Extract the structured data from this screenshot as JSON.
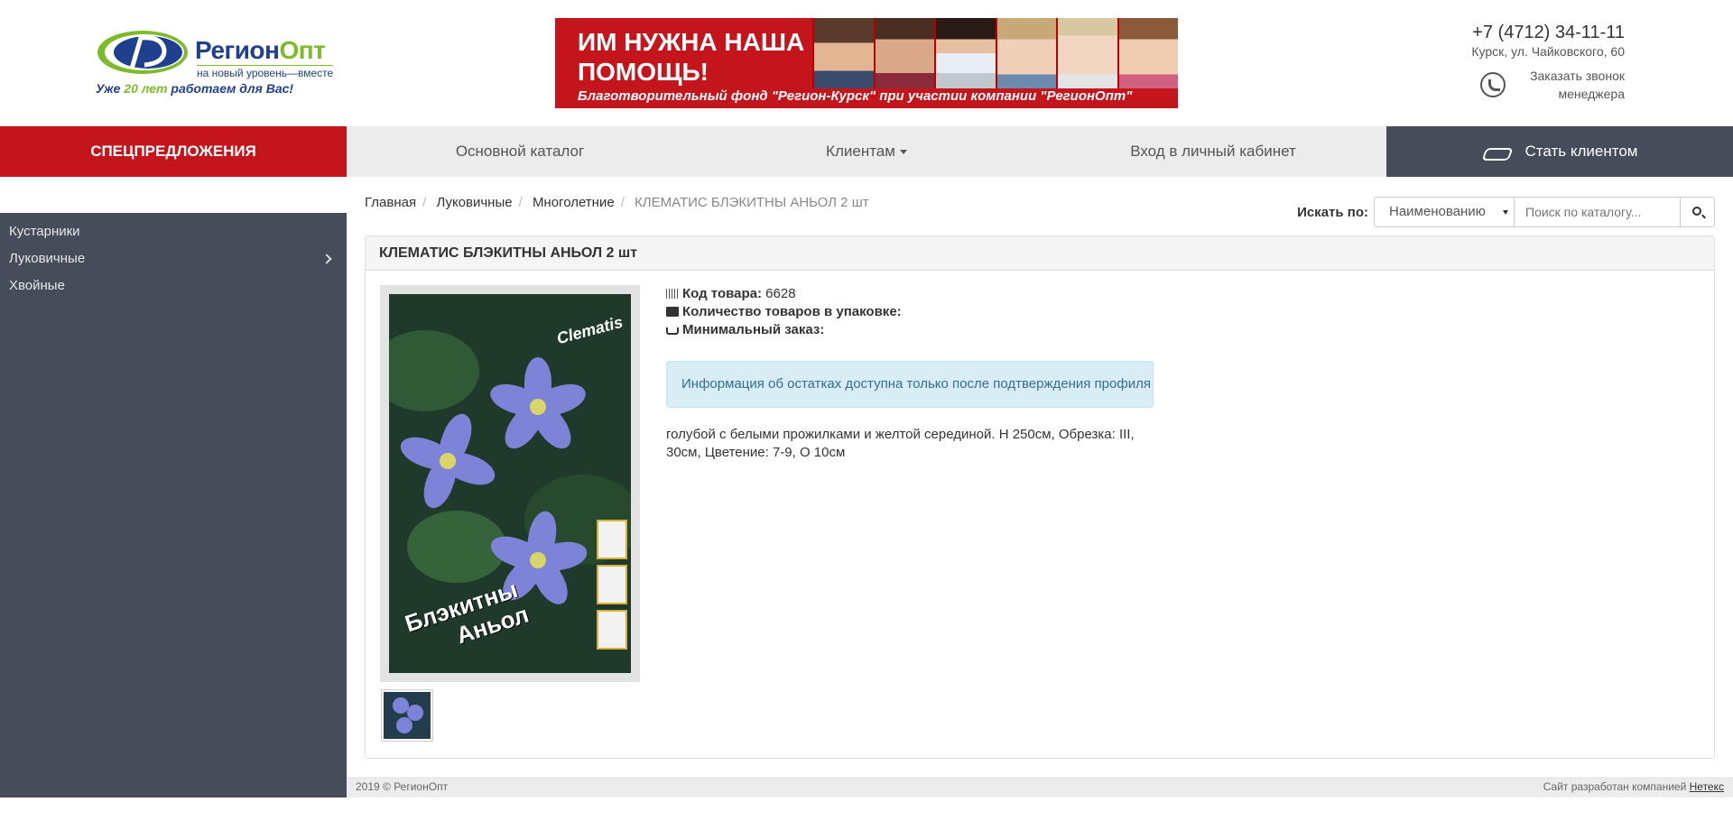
{
  "header": {
    "logo": {
      "brand_main": "Регион",
      "brand_accent": "Опт",
      "tagline": "на новый уровень—вместе",
      "slogan_prefix": "Уже ",
      "slogan_number": "20 лет",
      "slogan_suffix": " работаем для Вас!"
    },
    "banner": {
      "title": "ИМ НУЖНА НАША ПОМОЩЬ!",
      "subtitle": "Благотворительный фонд \"Регион-Курск\" при участии компании \"РегионОпт\""
    },
    "phone": "+7 (4712) 34-11-11",
    "address": "Курск, ул. Чайковского, 60",
    "callback_line1": "Заказать звонок",
    "callback_line2": "менеджера"
  },
  "nav": {
    "special": "СПЕЦПРЕДЛОЖЕНИЯ",
    "catalog": "Основной каталог",
    "clients": "Клиентам",
    "login": "Вход в личный кабинет",
    "become_client": "Стать клиентом"
  },
  "sidebar": {
    "items": [
      {
        "label": "Кустарники"
      },
      {
        "label": "Луковичные"
      },
      {
        "label": "Хвойные"
      }
    ]
  },
  "breadcrumb": {
    "items": [
      "Главная",
      "Луковичные",
      "Многолетние"
    ],
    "current": "КЛЕМАТИС БЛЭКИТНЫ АНЬОЛ 2 шт"
  },
  "search": {
    "label": "Искать по:",
    "select_value": "Наименованию",
    "placeholder": "Поиск по каталогу..."
  },
  "product": {
    "title": "КЛЕМАТИС БЛЭКИТНЫ АНЬОЛ 2 шт",
    "code_label": "Код товара:",
    "code_value": "6628",
    "qty_label": "Количество товаров в упаковке:",
    "min_order_label": "Минимальный заказ:",
    "stock_notice": "Информация об остатках доступна только после подтверждения профиля",
    "description": "голубой с белыми прожилками и желтой серединой. H 250см, Обрезка: III, 30см, Цветение: 7-9, O 10см",
    "photo_title_1": "Блэкитны",
    "photo_title_2": "Аньол",
    "photo_brand": "Clematis"
  },
  "footer": {
    "copyright": "2019 © РегионОпт",
    "dev_prefix": "Сайт разработан компанией",
    "dev_link": "Нетекс"
  }
}
